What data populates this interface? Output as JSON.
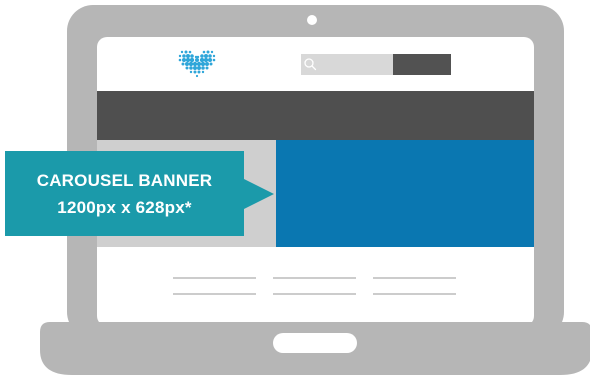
{
  "callout": {
    "title": "CAROUSEL BANNER",
    "dimensions": "1200px x 628px*"
  },
  "colors": {
    "laptop_frame": "#b6b6b6",
    "nav_bar": "#4f4f4f",
    "search_bar": "#d8d8d8",
    "search_button": "#525252",
    "carousel_banner": "#0a77b1",
    "callout": "#1b9aaa",
    "logo": "#2fa6d9",
    "content_lines": "#cccccc"
  },
  "icons": {
    "logo": "heart-logo-icon",
    "search": "search-icon"
  }
}
